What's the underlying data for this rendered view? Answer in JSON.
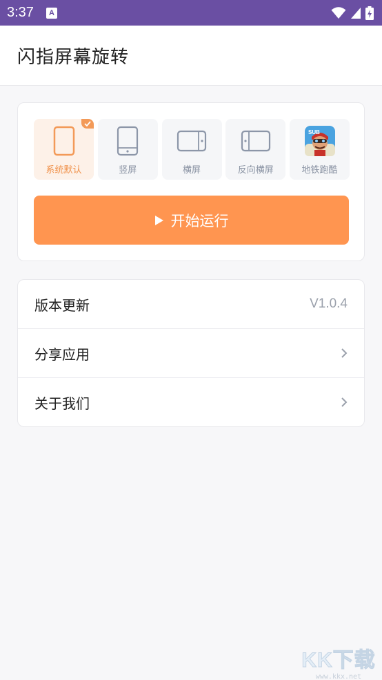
{
  "status_bar": {
    "time": "3:37",
    "notif_letter": "A"
  },
  "app_bar": {
    "title": "闪指屏幕旋转"
  },
  "modes": [
    {
      "label": "系统默认",
      "icon": "phone-outline-icon",
      "selected": true
    },
    {
      "label": "竖屏",
      "icon": "portrait-icon",
      "selected": false
    },
    {
      "label": "横屏",
      "icon": "landscape-icon",
      "selected": false
    },
    {
      "label": "反向横屏",
      "icon": "reverse-landscape-icon",
      "selected": false
    },
    {
      "label": "地铁跑酷",
      "icon": "subway-surfers-app-icon",
      "selected": false
    }
  ],
  "start_button": {
    "label": "开始运行"
  },
  "menu": {
    "version": {
      "label": "版本更新",
      "value": "V1.0.4"
    },
    "share": {
      "label": "分享应用"
    },
    "about": {
      "label": "关于我们"
    }
  },
  "watermark": {
    "logo": "KK下载",
    "url": "www.kkx.net"
  },
  "colors": {
    "status_bar": "#6a4fa3",
    "accent": "#ff9550",
    "selected_bg": "#fdf1e8"
  }
}
